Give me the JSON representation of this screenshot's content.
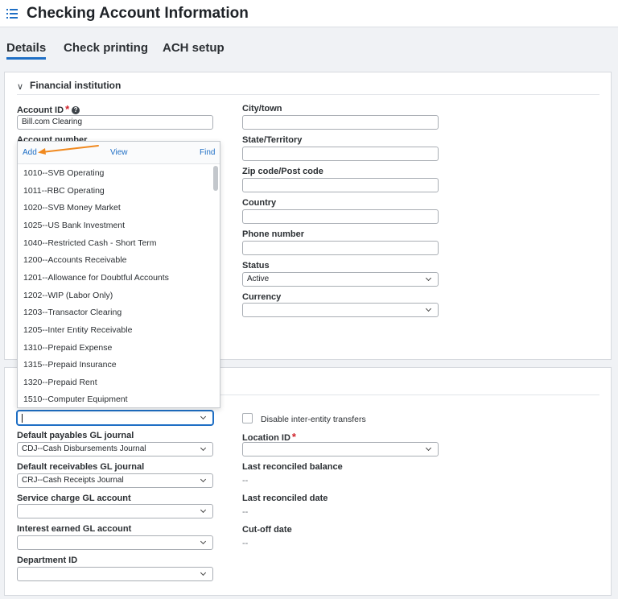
{
  "header": {
    "title": "Checking Account Information"
  },
  "tabs": [
    {
      "label": "Details",
      "active": true
    },
    {
      "label": "Check printing",
      "active": false
    },
    {
      "label": "ACH setup",
      "active": false
    }
  ],
  "financial_institution": {
    "section_label": "Financial institution",
    "account_id_label": "Account ID",
    "account_id_value": "Bill.com Clearing",
    "account_number_label": "Account number",
    "city_label": "City/town",
    "city_value": "",
    "state_label": "State/Territory",
    "state_value": "",
    "zip_label": "Zip code/Post code",
    "zip_value": "",
    "country_label": "Country",
    "country_value": "",
    "phone_label": "Phone number",
    "phone_value": "",
    "status_label": "Status",
    "status_value": "Active",
    "currency_label": "Currency",
    "currency_value": ""
  },
  "gl_dropdown": {
    "add_label": "Add",
    "view_label": "View",
    "find_label": "Find",
    "items": [
      "1010--SVB Operating",
      "1011--RBC Operating",
      "1020--SVB Money Market",
      "1025--US Bank Investment",
      "1040--Restricted Cash - Short Term",
      "1200--Accounts Receivable",
      "1201--Allowance for Doubtful Accounts",
      "1202--WIP (Labor Only)",
      "1203--Transactor Clearing",
      "1205--Inter Entity Receivable",
      "1310--Prepaid Expense",
      "1315--Prepaid Insurance",
      "1320--Prepaid Rent",
      "1510--Computer Equipment"
    ]
  },
  "accounting": {
    "gl_account_value": "",
    "disable_transfers_label": "Disable inter-entity transfers",
    "payables_journal_label": "Default payables GL journal",
    "payables_journal_value": "CDJ--Cash Disbursements Journal",
    "location_label": "Location ID",
    "location_value": "",
    "receivables_journal_label": "Default receivables GL journal",
    "receivables_journal_value": "CRJ--Cash Receipts Journal",
    "last_balance_label": "Last reconciled balance",
    "last_balance_value": "--",
    "service_charge_label": "Service charge GL account",
    "service_charge_value": "",
    "last_date_label": "Last reconciled date",
    "last_date_value": "--",
    "interest_label": "Interest earned GL account",
    "interest_value": "",
    "cutoff_label": "Cut-off date",
    "cutoff_value": "--",
    "department_label": "Department ID",
    "department_value": ""
  },
  "colors": {
    "accent": "#1f6fc5",
    "arrow": "#f0891f",
    "required": "#d0222b"
  }
}
